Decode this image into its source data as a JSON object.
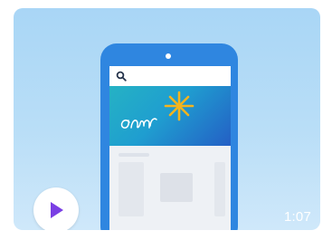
{
  "video": {
    "duration": "1:07",
    "accent_color": "#7a3fe4",
    "background_color": "#a9d6f6",
    "play_icon": "play-icon"
  },
  "phone": {
    "color": "#2f86e0",
    "search_icon": "search-icon",
    "banner_decoration": [
      "scribble-icon",
      "sparkle-icon"
    ]
  }
}
